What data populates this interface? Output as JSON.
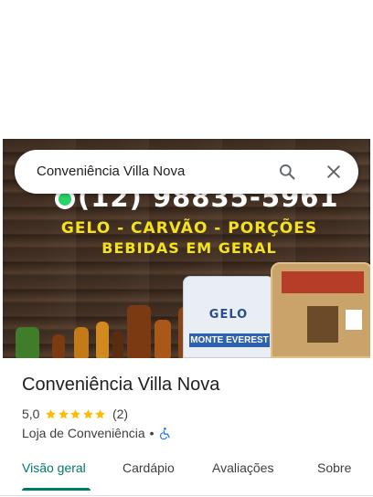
{
  "search": {
    "query": "Conveniência Villa Nova"
  },
  "photo": {
    "phone": "(12) 98835-5961",
    "line1": "GELO - CARVÃO - PORÇÕES",
    "line2": "BEBIDAS EM GERAL",
    "ice_bag_brand": "GELO",
    "ice_bag_name": "MONTE EVEREST"
  },
  "place": {
    "name": "Conveniência Villa Nova",
    "rating": "5,0",
    "stars": 5,
    "review_count": "(2)",
    "category": "Loja de Conveniência",
    "separator": "•",
    "accessibility_icon": "wheelchair-icon"
  },
  "tabs": [
    {
      "label": "Visão geral",
      "active": true
    },
    {
      "label": "Cardápio",
      "active": false
    },
    {
      "label": "Avaliações",
      "active": false
    },
    {
      "label": "Sobre",
      "active": false
    }
  ],
  "colors": {
    "accent": "#00796b",
    "star": "#fbbc04",
    "accessibility": "#1a73e8",
    "photo_text": "#f4e21c"
  }
}
